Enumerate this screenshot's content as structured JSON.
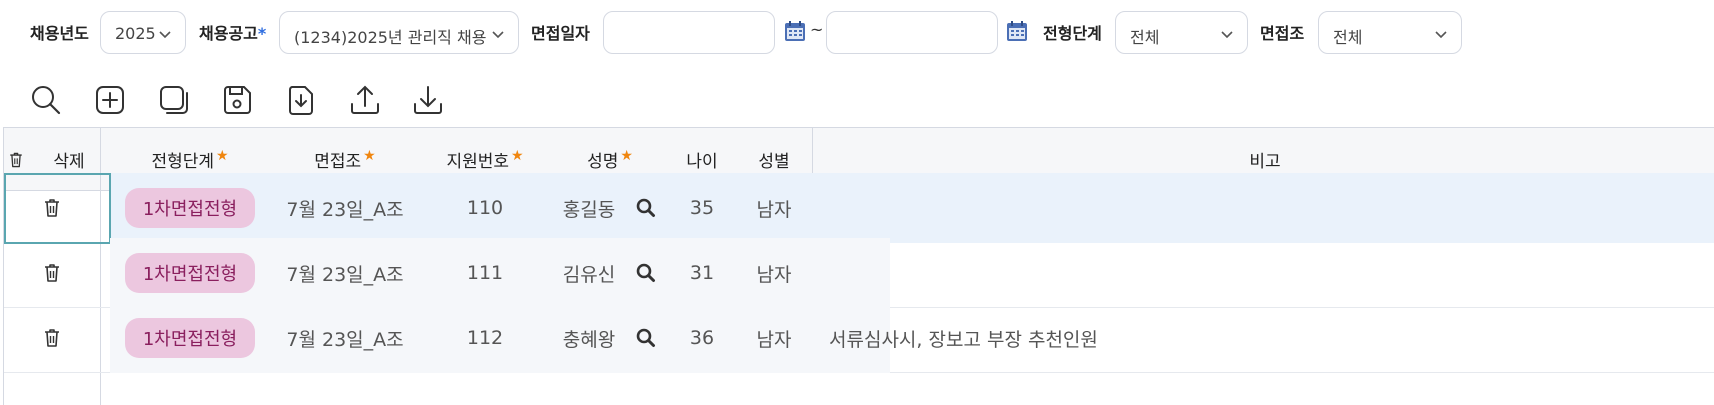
{
  "filters": {
    "year": {
      "label": "채용년도",
      "value": "2025"
    },
    "posting": {
      "label": "채용공고",
      "required_mark": "*",
      "value": "(1234)2025년 관리직 채용"
    },
    "interview_date": {
      "label": "면접일자",
      "from_value": "",
      "to_value": "",
      "separator": "~"
    },
    "stage": {
      "label": "전형단계",
      "value": "전체"
    },
    "group": {
      "label": "면접조",
      "value": "전체"
    }
  },
  "toolbar": {
    "icons": [
      "search-icon",
      "add-icon",
      "copy-icon",
      "save-icon",
      "import-icon",
      "upload-icon",
      "download-icon"
    ]
  },
  "grid": {
    "headers": {
      "delete": "삭제",
      "stage": "전형단계",
      "group": "면접조",
      "applicant_no": "지원번호",
      "name": "성명",
      "age": "나이",
      "gender": "성별",
      "remarks": "비고"
    },
    "required_mark": "★",
    "rows": [
      {
        "stage": "1차면접전형",
        "group": "7월 23일_A조",
        "applicant_no": "110",
        "name": "홍길동",
        "age": "35",
        "gender": "남자",
        "remarks": ""
      },
      {
        "stage": "1차면접전형",
        "group": "7월 23일_A조",
        "applicant_no": "111",
        "name": "김유신",
        "age": "31",
        "gender": "남자",
        "remarks": ""
      },
      {
        "stage": "1차면접전형",
        "group": "7월 23일_A조",
        "applicant_no": "112",
        "name": "충혜왕",
        "age": "36",
        "gender": "남자",
        "remarks": "서류심사시, 장보고 부장 추천인원"
      }
    ]
  },
  "colors": {
    "accent": "#2d6cdf",
    "star": "#f0860f",
    "badge_bg": "#ecc7df",
    "badge_text": "#8a1f5e",
    "selected_row": "#eaf2fb",
    "focus_border": "#5aa6b0",
    "calendar_icon": "#4b6fb5"
  }
}
